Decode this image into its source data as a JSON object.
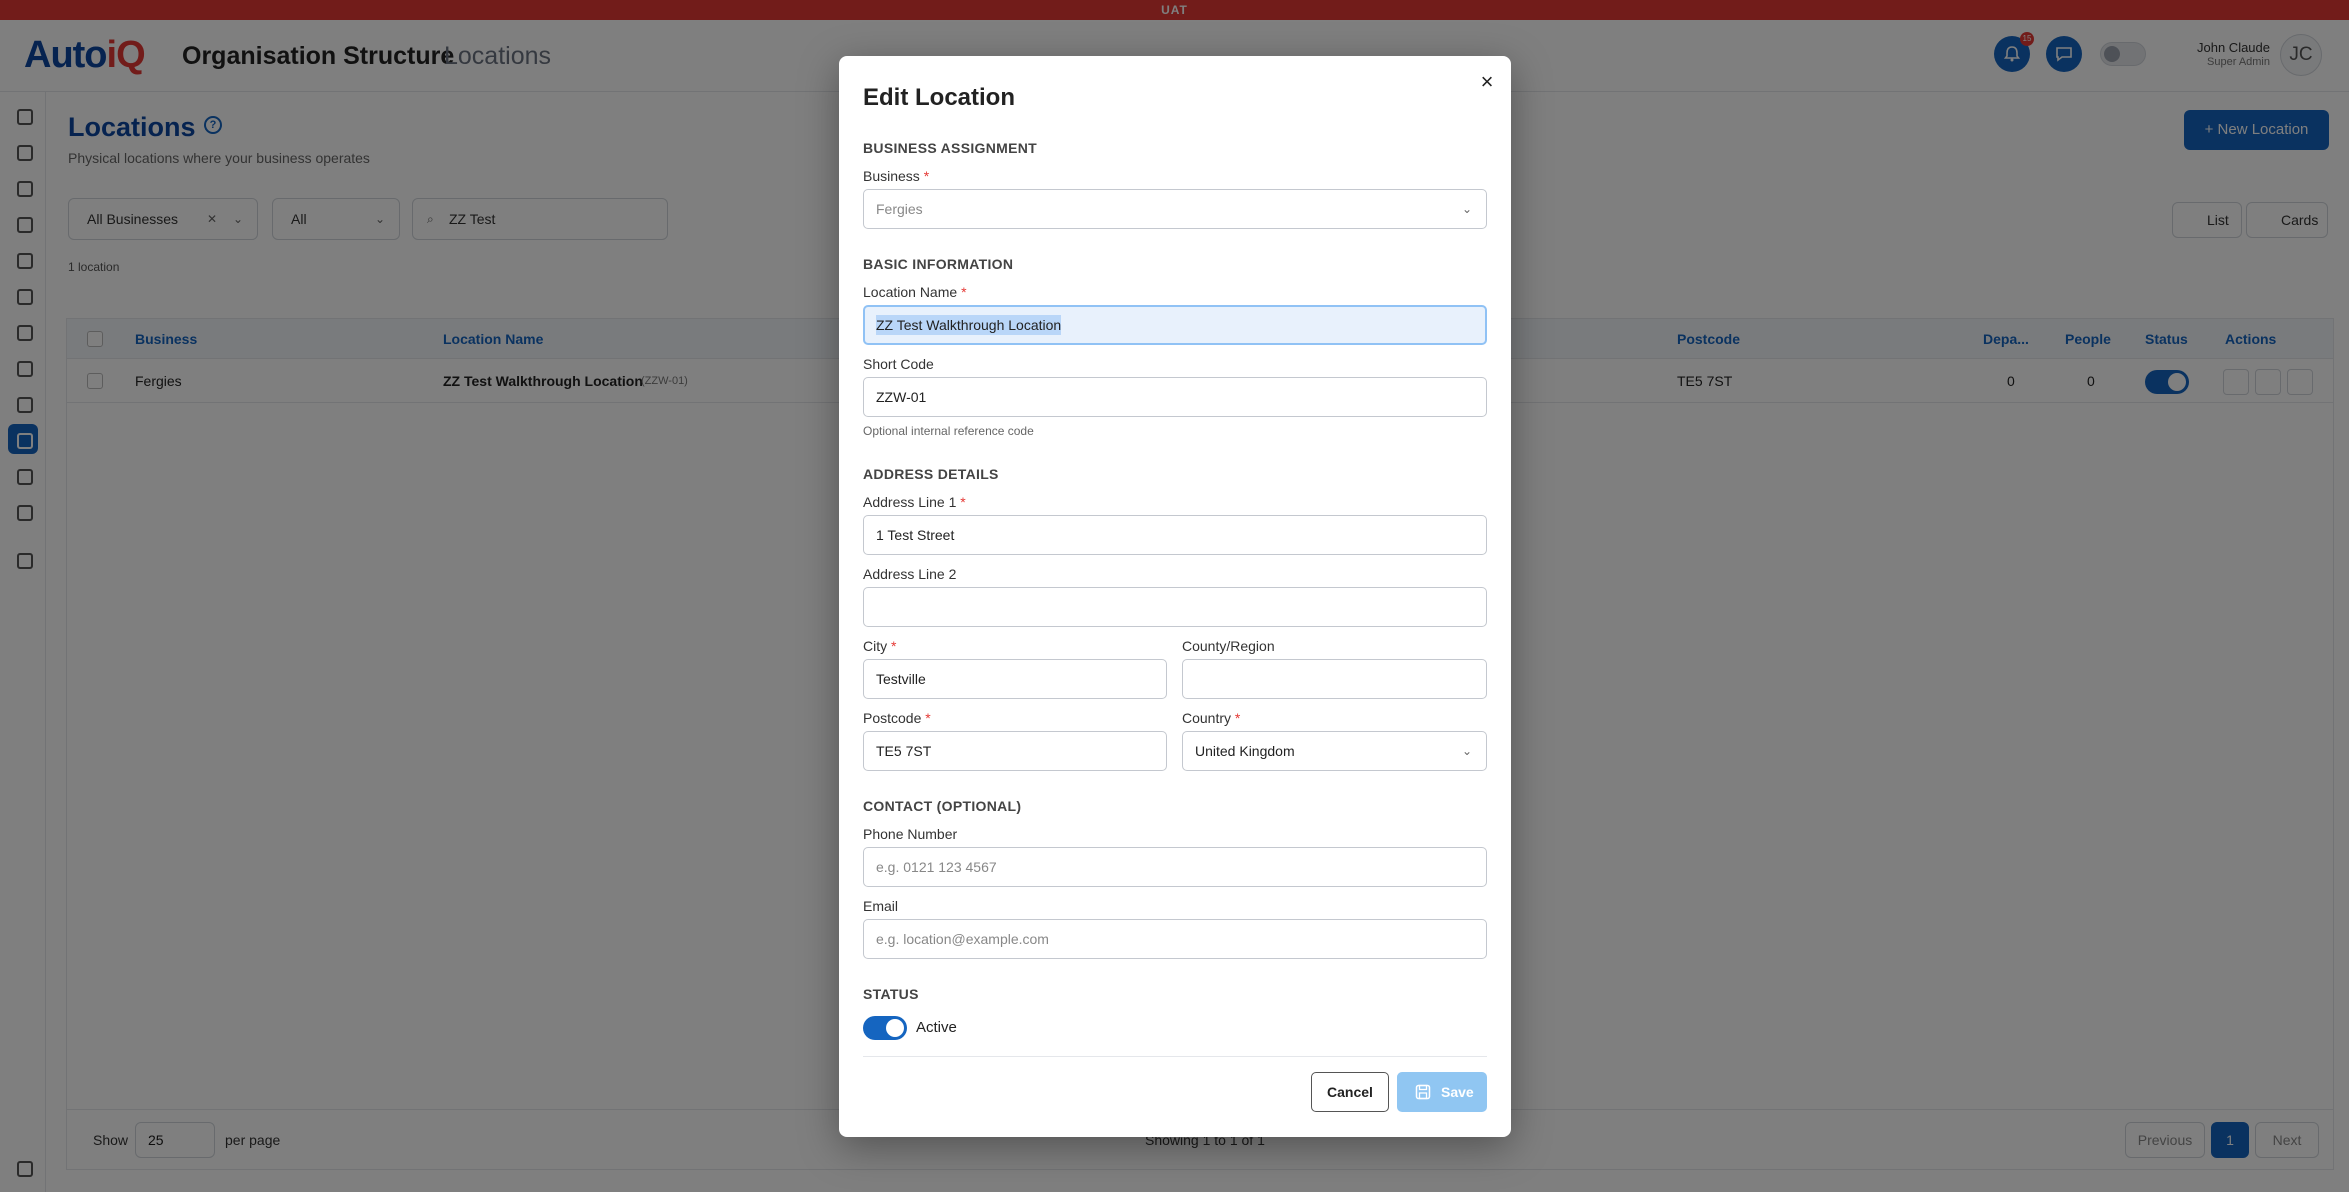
{
  "env": {
    "banner": "UAT"
  },
  "header": {
    "logo_primary": "Auto",
    "logo_accent": "iQ",
    "title": "Organisation Structure",
    "subtitle": "Locations",
    "notif_count": "15",
    "user_name": "John Claude",
    "user_role": "Super Admin",
    "avatar_initials": "JC"
  },
  "page": {
    "title": "Locations",
    "subtitle": "Physical locations where your business operates",
    "new_button": "New Location",
    "count": "1 location"
  },
  "filters": {
    "business": "All Businesses",
    "status": "All",
    "search": "ZZ Test",
    "view_list": "List",
    "view_cards": "Cards"
  },
  "table": {
    "columns": {
      "business": "Business",
      "location_name": "Location Name",
      "postcode": "Postcode",
      "departments": "Depa...",
      "people": "People",
      "status": "Status",
      "actions": "Actions"
    },
    "rows": [
      {
        "business": "Fergies",
        "name": "ZZ Test Walkthrough Location",
        "code": "(ZZW-01)",
        "postcode": "TE5 7ST",
        "departments": "0",
        "people": "0"
      }
    ],
    "footer": {
      "show": "Show",
      "per_page_value": "25",
      "per_page": "per page",
      "showing": "Showing 1 to 1 of 1",
      "previous": "Previous",
      "page": "1",
      "next": "Next"
    }
  },
  "modal": {
    "title": "Edit Location",
    "close": "×",
    "section_business": "BUSINESS ASSIGNMENT",
    "business_label": "Business",
    "business_value": "Fergies",
    "section_basic": "BASIC INFORMATION",
    "location_name_label": "Location Name",
    "location_name_value": "ZZ Test Walkthrough Location",
    "short_code_label": "Short Code",
    "short_code_value": "ZZW-01",
    "short_code_hint": "Optional internal reference code",
    "section_address": "ADDRESS DETAILS",
    "address1_label": "Address Line 1",
    "address1_value": "1 Test Street",
    "address2_label": "Address Line 2",
    "address2_value": "",
    "city_label": "City",
    "city_value": "Testville",
    "county_label": "County/Region",
    "county_value": "",
    "postcode_label": "Postcode",
    "postcode_value": "TE5 7ST",
    "country_label": "Country",
    "country_value": "United Kingdom",
    "section_contact": "CONTACT (OPTIONAL)",
    "phone_label": "Phone Number",
    "phone_placeholder": "e.g. 0121 123 4567",
    "email_label": "Email",
    "email_placeholder": "e.g. location@example.com",
    "section_status": "STATUS",
    "status_label": "Active",
    "required_mark": "*",
    "cancel": "Cancel",
    "save": "Save"
  },
  "colors": {
    "primary": "#1565c0",
    "banner": "#e53935",
    "save_disabled": "#90c6f2"
  }
}
